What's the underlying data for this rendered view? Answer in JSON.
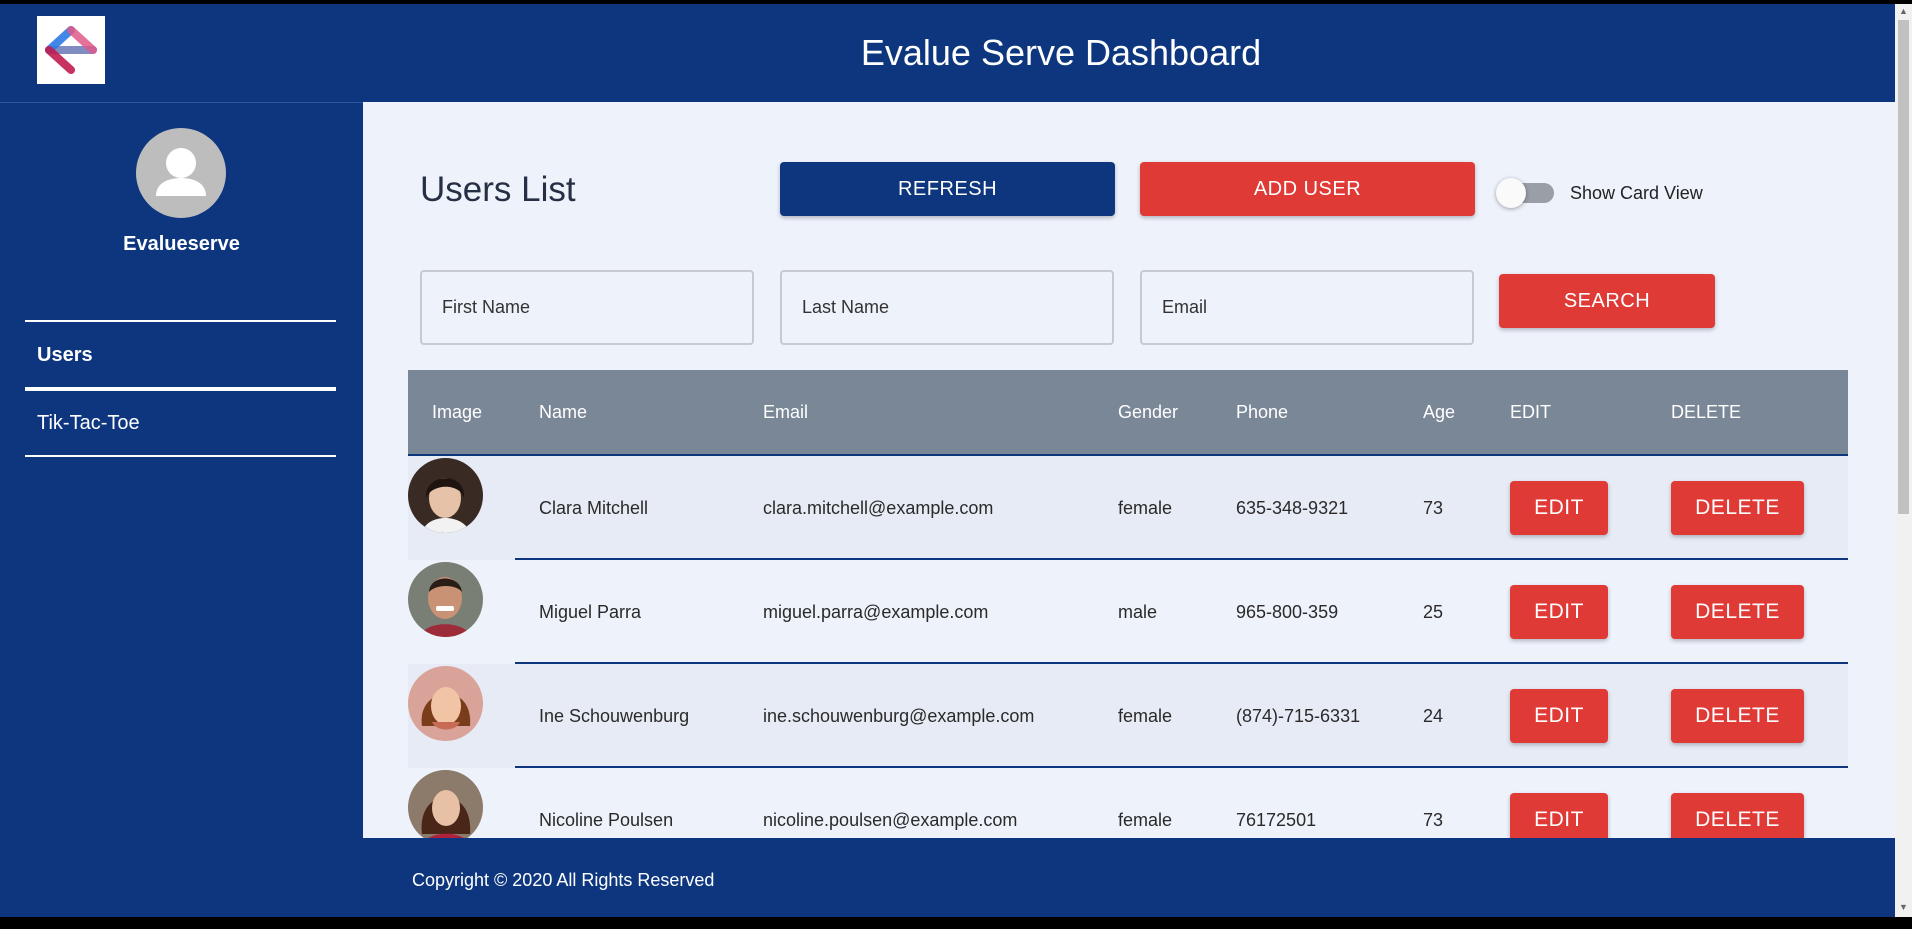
{
  "header": {
    "title": "Evalue Serve Dashboard"
  },
  "sidebar": {
    "profile_name": "Evalueserve",
    "items": [
      {
        "label": "Users"
      },
      {
        "label": "Tik-Tac-Toe"
      }
    ]
  },
  "main": {
    "title": "Users List",
    "refresh_label": "REFRESH",
    "add_user_label": "ADD USER",
    "toggle_label": "Show Card View",
    "toggle_on": false,
    "search": {
      "first_name_placeholder": "First Name",
      "last_name_placeholder": "Last Name",
      "email_placeholder": "Email",
      "button_label": "SEARCH"
    }
  },
  "table": {
    "columns": [
      "Image",
      "Name",
      "Email",
      "Gender",
      "Phone",
      "Age",
      "EDIT",
      "DELETE"
    ],
    "edit_label": "EDIT",
    "delete_label": "DELETE",
    "rows": [
      {
        "name": "Clara Mitchell",
        "email": "clara.mitchell@example.com",
        "gender": "female",
        "phone": "635-348-9321",
        "age": "73"
      },
      {
        "name": "Miguel Parra",
        "email": "miguel.parra@example.com",
        "gender": "male",
        "phone": "965-800-359",
        "age": "25"
      },
      {
        "name": "Ine Schouwenburg",
        "email": "ine.schouwenburg@example.com",
        "gender": "female",
        "phone": "(874)-715-6331",
        "age": "24"
      },
      {
        "name": "Nicoline Poulsen",
        "email": "nicoline.poulsen@example.com",
        "gender": "female",
        "phone": "76172501",
        "age": "73"
      }
    ]
  },
  "footer": {
    "copyright": "Copyright © 2020 All Rights Reserved"
  },
  "colors": {
    "primary": "#0d367e",
    "accent": "#e03a37",
    "background": "#eef2fb",
    "table_header": "#7a8797"
  }
}
